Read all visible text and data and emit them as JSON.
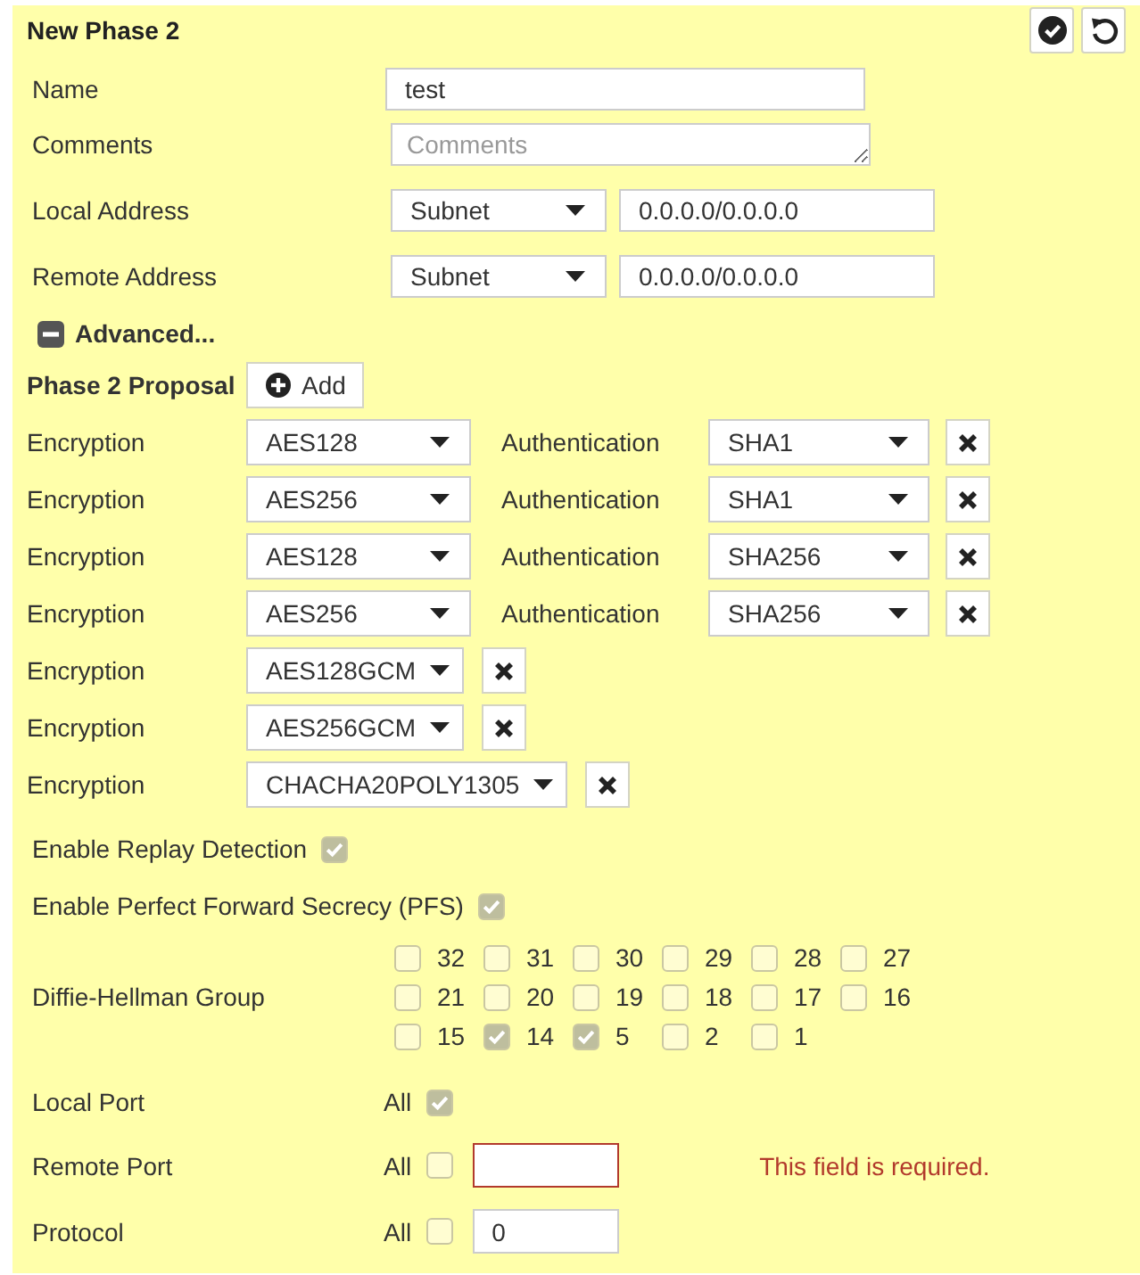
{
  "panel": {
    "title": "New Phase 2"
  },
  "fields": [
    {
      "label": "Name",
      "kind": "text",
      "value": "test"
    },
    {
      "label": "Comments",
      "kind": "textarea",
      "placeholder": "Comments"
    },
    {
      "label": "Local Address",
      "kind": "address",
      "type": "Subnet",
      "value": "0.0.0.0/0.0.0.0"
    },
    {
      "label": "Remote Address",
      "kind": "address",
      "type": "Subnet",
      "value": "0.0.0.0/0.0.0.0"
    }
  ],
  "advanced": {
    "label": "Advanced...",
    "expanded": true
  },
  "proposal": {
    "label": "Phase 2 Proposal",
    "add_button": "Add",
    "rows": [
      {
        "encryption_label": "Encryption",
        "encryption": "AES128",
        "authentication_label": "Authentication",
        "authentication": "SHA1"
      },
      {
        "encryption_label": "Encryption",
        "encryption": "AES256",
        "authentication_label": "Authentication",
        "authentication": "SHA1"
      },
      {
        "encryption_label": "Encryption",
        "encryption": "AES128",
        "authentication_label": "Authentication",
        "authentication": "SHA256"
      },
      {
        "encryption_label": "Encryption",
        "encryption": "AES256",
        "authentication_label": "Authentication",
        "authentication": "SHA256"
      },
      {
        "encryption_label": "Encryption",
        "encryption": "AES128GCM"
      },
      {
        "encryption_label": "Encryption",
        "encryption": "AES256GCM"
      },
      {
        "encryption_label": "Encryption",
        "encryption": "CHACHA20POLY1305"
      }
    ]
  },
  "options": [
    {
      "label": "Enable Replay Detection",
      "checked": true
    },
    {
      "label": "Enable Perfect Forward Secrecy (PFS)",
      "checked": true
    }
  ],
  "dh_group": {
    "label": "Diffie-Hellman Group",
    "groups": [
      {
        "number": "32",
        "checked": false
      },
      {
        "number": "31",
        "checked": false
      },
      {
        "number": "30",
        "checked": false
      },
      {
        "number": "29",
        "checked": false
      },
      {
        "number": "28",
        "checked": false
      },
      {
        "number": "27",
        "checked": false
      },
      {
        "number": "21",
        "checked": false
      },
      {
        "number": "20",
        "checked": false
      },
      {
        "number": "19",
        "checked": false
      },
      {
        "number": "18",
        "checked": false
      },
      {
        "number": "17",
        "checked": false
      },
      {
        "number": "16",
        "checked": false
      },
      {
        "number": "15",
        "checked": false
      },
      {
        "number": "14",
        "checked": true
      },
      {
        "number": "5",
        "checked": true
      },
      {
        "number": "2",
        "checked": false
      },
      {
        "number": "1",
        "checked": false
      }
    ]
  },
  "ports": [
    {
      "label": "Local Port",
      "all_label": "All",
      "checked": true
    },
    {
      "label": "Remote Port",
      "all_label": "All",
      "checked": false,
      "invalid": true,
      "error": "This field is required."
    },
    {
      "label": "Protocol",
      "all_label": "All",
      "checked": false,
      "invalid": false,
      "value": "0"
    }
  ]
}
